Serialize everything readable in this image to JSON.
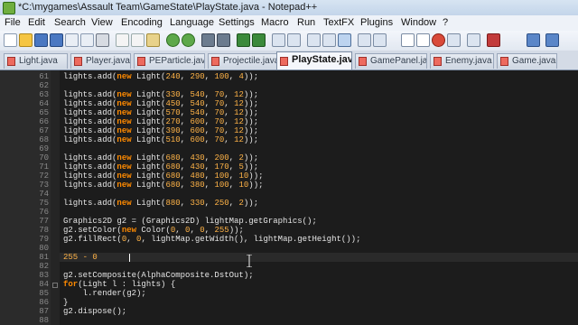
{
  "window": {
    "title": "*C:\\mygames\\Assault Team\\GameState\\PlayState.java - Notepad++"
  },
  "menu": [
    "File",
    "Edit",
    "Search",
    "View",
    "Encoding",
    "Language",
    "Settings",
    "Macro",
    "Run",
    "TextFX",
    "Plugins",
    "Window",
    "?"
  ],
  "toolbar_icons": [
    "new-icon",
    "open-icon",
    "save-icon",
    "save-all-icon",
    "close-icon",
    "close-all-icon",
    "print-icon",
    "cut-icon",
    "copy-icon",
    "paste-icon",
    "undo-icon",
    "redo-icon",
    "find-icon",
    "replace-icon",
    "zoom-in-icon",
    "zoom-out-icon",
    "sync-v-icon",
    "sync-h-icon",
    "wrap-icon",
    "all-chars-icon",
    "indent-guide-icon",
    "udl-icon",
    "doc-map-icon",
    "record-icon",
    "stop-icon",
    "play-icon",
    "play-multi-icon",
    "save-macro-icon",
    "run-icon",
    "up-icon",
    "down-icon"
  ],
  "tabs": [
    {
      "label": "Light.java",
      "active": false
    },
    {
      "label": "Player.java",
      "active": false
    },
    {
      "label": "PEParticle.java",
      "active": false
    },
    {
      "label": "Projectile.java",
      "active": false
    },
    {
      "label": "PlayState.java",
      "active": true
    },
    {
      "label": "GamePanel.java",
      "active": false
    },
    {
      "label": "Enemy.java",
      "active": false
    },
    {
      "label": "Game.java",
      "active": false
    }
  ],
  "lines": [
    {
      "n": "61",
      "text": "lights.add(new Light(240, 290, 100, 4));"
    },
    {
      "n": "62",
      "text": ""
    },
    {
      "n": "63",
      "text": "lights.add(new Light(330, 540, 70, 12));"
    },
    {
      "n": "64",
      "text": "lights.add(new Light(450, 540, 70, 12));"
    },
    {
      "n": "65",
      "text": "lights.add(new Light(570, 540, 70, 12));"
    },
    {
      "n": "66",
      "text": "lights.add(new Light(270, 600, 70, 12));"
    },
    {
      "n": "67",
      "text": "lights.add(new Light(390, 600, 70, 12));"
    },
    {
      "n": "68",
      "text": "lights.add(new Light(510, 600, 70, 12));"
    },
    {
      "n": "69",
      "text": ""
    },
    {
      "n": "70",
      "text": "lights.add(new Light(680, 430, 200, 2));"
    },
    {
      "n": "71",
      "text": "lights.add(new Light(680, 430, 170, 5));"
    },
    {
      "n": "72",
      "text": "lights.add(new Light(680, 480, 100, 10));"
    },
    {
      "n": "73",
      "text": "lights.add(new Light(680, 380, 100, 10));"
    },
    {
      "n": "74",
      "text": ""
    },
    {
      "n": "75",
      "text": "lights.add(new Light(880, 330, 250, 2));"
    },
    {
      "n": "76",
      "text": ""
    },
    {
      "n": "77",
      "text": "Graphics2D g2 = (Graphics2D) lightMap.getGraphics();"
    },
    {
      "n": "78",
      "text": "g2.setColor(new Color(0, 0, 0, 255));"
    },
    {
      "n": "79",
      "text": "g2.fillRect(0, 0, lightMap.getWidth(), lightMap.getHeight());"
    },
    {
      "n": "80",
      "text": ""
    },
    {
      "n": "81",
      "text": "255 - 0"
    },
    {
      "n": "82",
      "text": ""
    },
    {
      "n": "83",
      "text": "g2.setComposite(AlphaComposite.DstOut);"
    },
    {
      "n": "84",
      "text": "for(Light l : lights) {"
    },
    {
      "n": "85",
      "text": "    l.render(g2);"
    },
    {
      "n": "86",
      "text": "}"
    },
    {
      "n": "87",
      "text": "g2.dispose();"
    },
    {
      "n": "88",
      "text": ""
    }
  ]
}
